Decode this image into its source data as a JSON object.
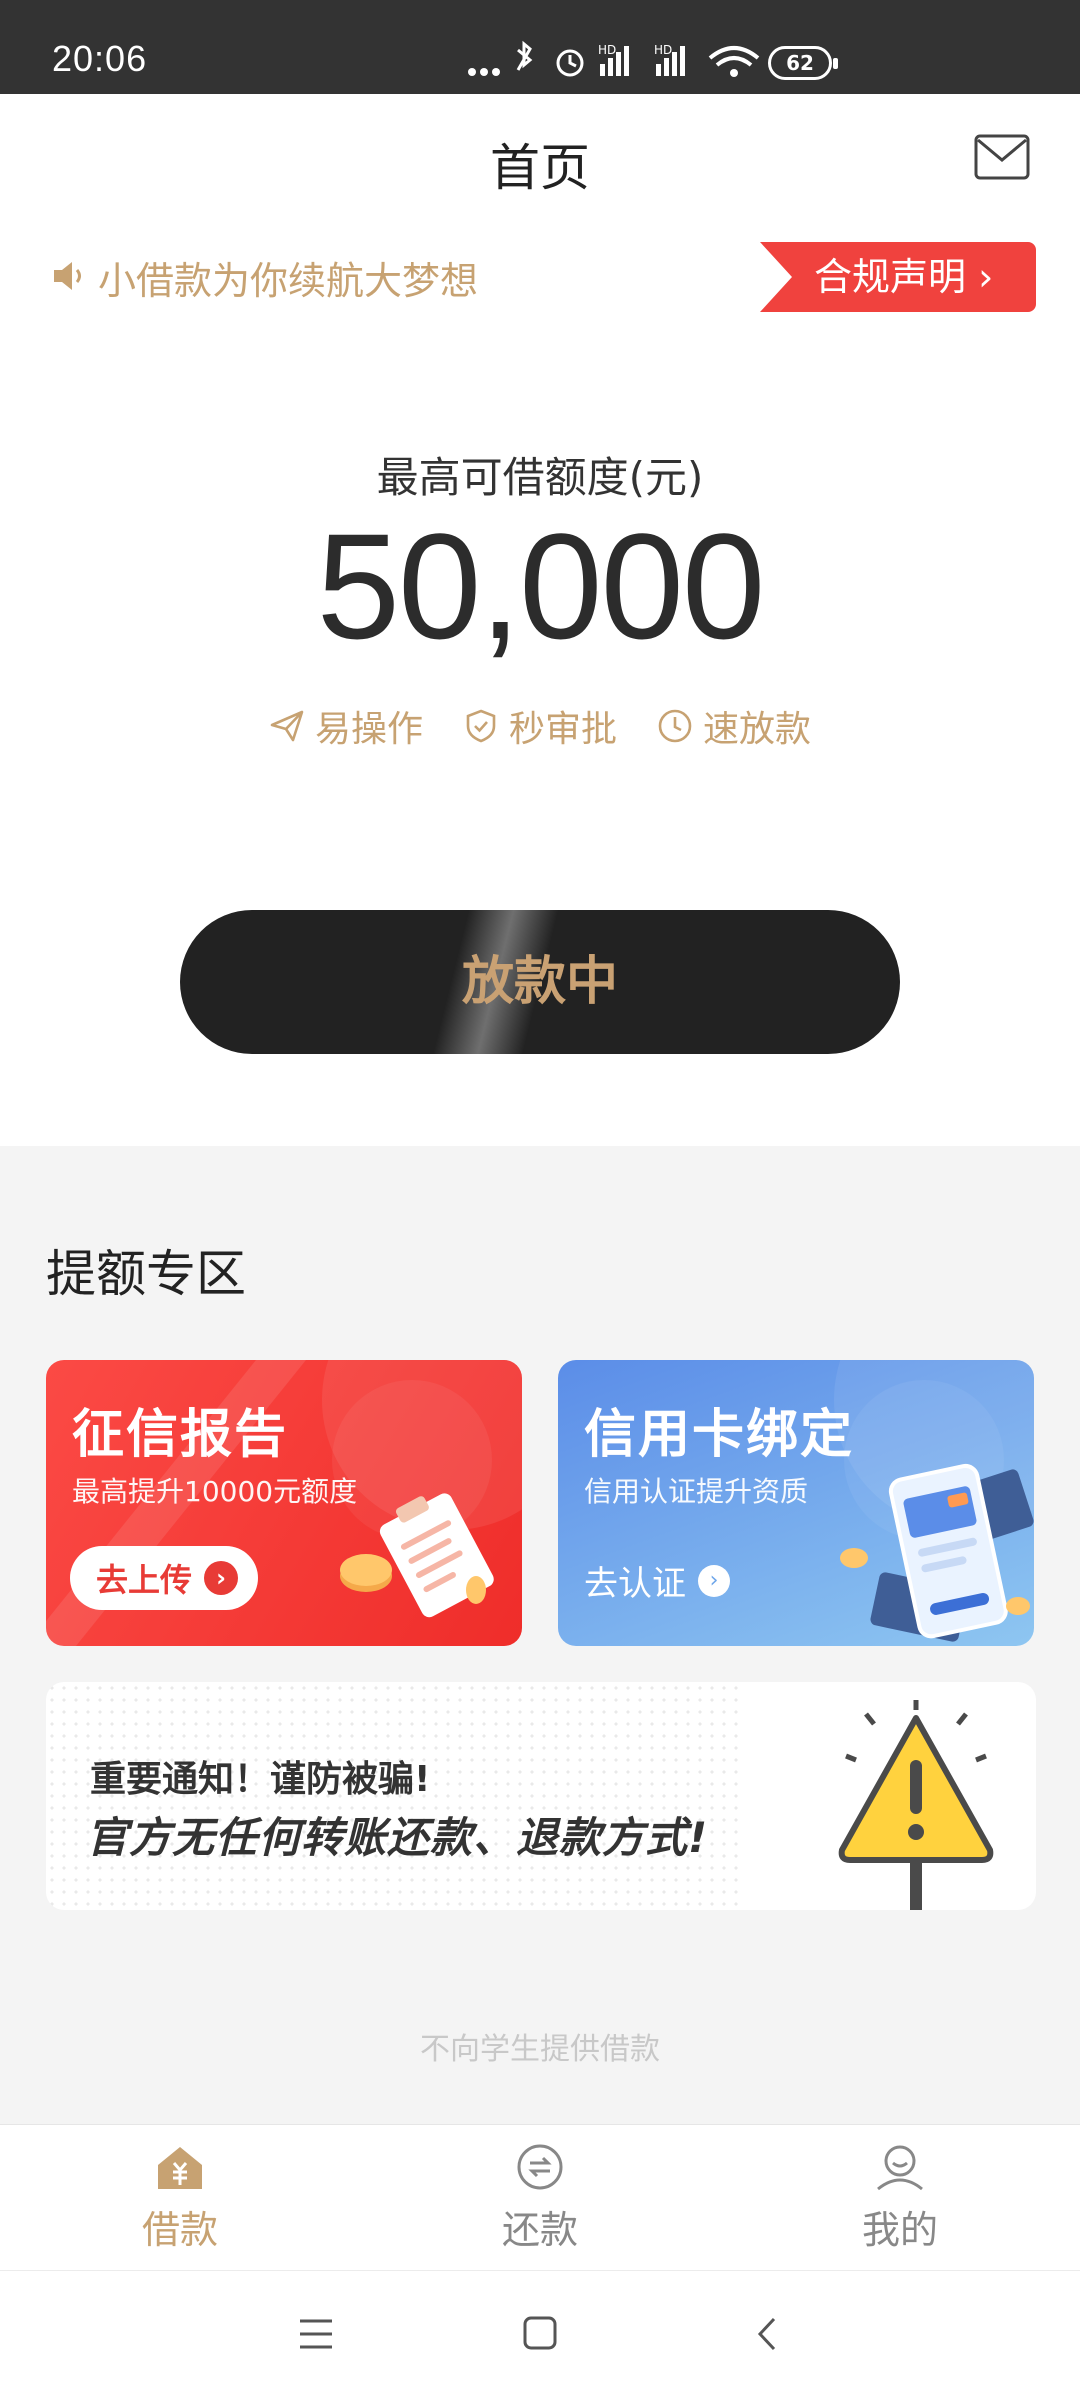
{
  "status_bar": {
    "time": "20:06",
    "battery": "62"
  },
  "header": {
    "title": "首页"
  },
  "announcement": {
    "slogan": "小借款为你续航大梦想",
    "compliance_label": "合规声明 ›"
  },
  "limit": {
    "label": "最高可借额度(元)",
    "amount": "50,000",
    "features": [
      "易操作",
      "秒审批",
      "速放款"
    ]
  },
  "loan_button": {
    "label": "放款中"
  },
  "boost_section": {
    "title": "提额专区",
    "cards": [
      {
        "title": "征信报告",
        "subtitle": "最高提升10000元额度",
        "action": "去上传"
      },
      {
        "title": "信用卡绑定",
        "subtitle": "信用认证提升资质",
        "action": "去认证"
      }
    ]
  },
  "notice": {
    "line1": "重要通知！谨防被骗!",
    "line2": "官方无任何转账还款、退款方式!"
  },
  "footnote": "不向学生提供借款",
  "tabbar": {
    "items": [
      {
        "label": "借款",
        "active": true
      },
      {
        "label": "还款",
        "active": false
      },
      {
        "label": "我的",
        "active": false
      }
    ]
  },
  "colors": {
    "accent_gold": "#c7a272",
    "compliance_red": "#f0423e",
    "button_dark": "#222222"
  }
}
